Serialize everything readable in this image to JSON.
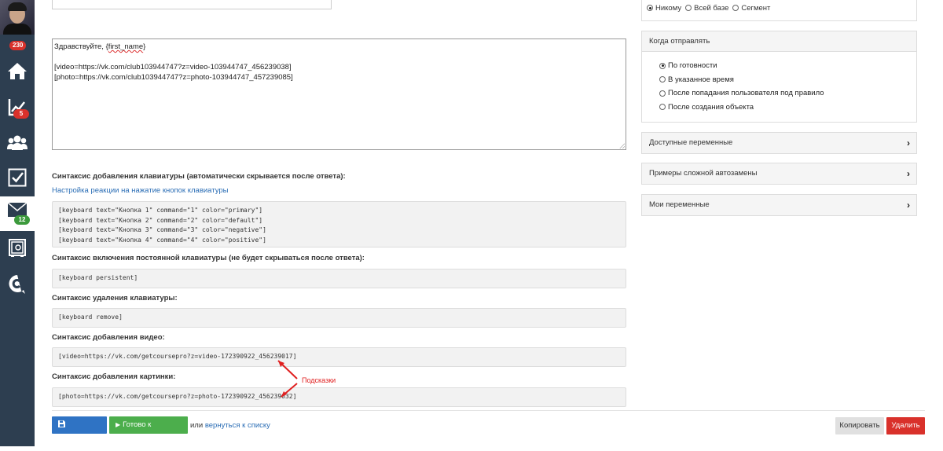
{
  "sidebar": {
    "avatar_badge": "230",
    "items": [
      {
        "name": "home-icon",
        "badge": ""
      },
      {
        "name": "chart-icon",
        "badge": "5"
      },
      {
        "name": "users-icon",
        "badge": ""
      },
      {
        "name": "tasks-icon",
        "badge": ""
      },
      {
        "name": "mail-icon",
        "badge": "12"
      },
      {
        "name": "safe-icon",
        "badge": ""
      },
      {
        "name": "getcourse-icon",
        "badge": ""
      }
    ]
  },
  "editor": {
    "greeting_prefix": "Здравствуйте, {",
    "greeting_var": "first_name",
    "greeting_suffix": "}",
    "line_video": "[video=https://vk.com/club103944747?z=video-103944747_456239038]",
    "line_photo": "[photo=https://vk.com/club103944747?z=photo-103944747_457239085]"
  },
  "keyboard": {
    "label": "Синтаксис добавления клавиатуры (автоматически скрывается после ответа):",
    "link": "Настройка реакции на нажатие кнопок клавиатуры",
    "code": "[keyboard text=\"Кнопка 1\" command=\"1\" color=\"primary\"]\n[keyboard text=\"Кнопка 2\" command=\"2\" color=\"default\"]\n[keyboard text=\"Кнопка 3\" command=\"3\" color=\"negative\"]\n[keyboard text=\"Кнопка 4\" command=\"4\" color=\"positive\"]"
  },
  "persistent": {
    "label": "Синтаксис включения постоянной клавиатуры (не будет скрываться после ответа):",
    "code": "[keyboard persistent]"
  },
  "remove": {
    "label": "Синтаксис удаления клавиатуры:",
    "code": "[keyboard remove]"
  },
  "video": {
    "label": "Синтаксис добавления видео:",
    "code": "[video=https://vk.com/getcoursepro?z=video-172390922_456239017]"
  },
  "photo": {
    "label": "Синтаксис добавления картинки:",
    "code": "[photo=https://vk.com/getcoursepro?z=photo-172390922_456239032]"
  },
  "annotation": {
    "hint": "Подсказки",
    "color": "#e02020"
  },
  "actions": {
    "save": "Сохранить",
    "ready": "Готово к отправке",
    "or": "или",
    "back": "вернуться к списку",
    "copy": "Копировать",
    "delete": "Удалить"
  },
  "audience": {
    "options": [
      {
        "label": "Никому",
        "checked": true
      },
      {
        "label": "Всей базе",
        "checked": false
      },
      {
        "label": "Сегмент",
        "checked": false
      }
    ]
  },
  "when": {
    "title": "Когда отправлять",
    "options": [
      {
        "label": "По готовности",
        "checked": true
      },
      {
        "label": "В указанное время",
        "checked": false
      },
      {
        "label": "После попадания пользователя под правило",
        "checked": false
      },
      {
        "label": "После создания объекта",
        "checked": false
      }
    ]
  },
  "panels": {
    "vars": "Доступные переменные",
    "examples": "Примеры сложной автозамены",
    "my_vars": "Мои переменные"
  },
  "colors": {
    "sidebar": "#2d3e50",
    "primary": "#2f73c4",
    "success": "#4cae4c",
    "danger": "#d9312b",
    "link": "#2a6db5"
  }
}
